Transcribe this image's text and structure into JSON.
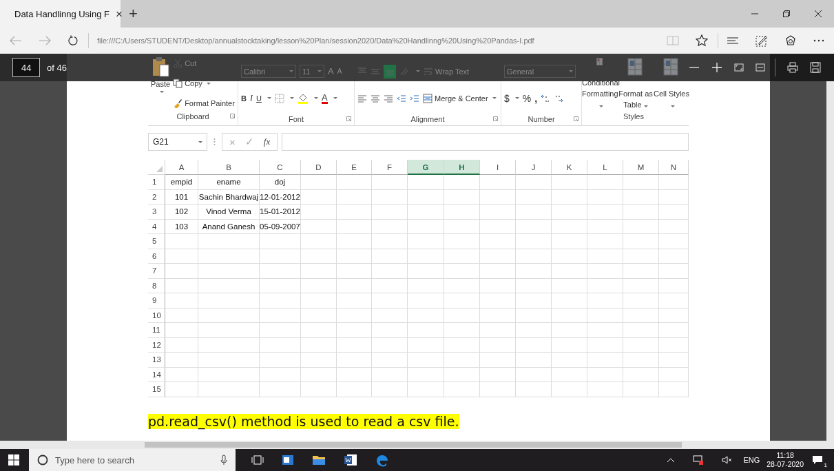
{
  "browser": {
    "tab_title": "Data Handlinng Using F",
    "tab_close": "×",
    "new_tab": "+",
    "url": "file:///C:/Users/STUDENT/Desktop/annualstocktaking/lesson%20Plan/session2020/Data%20Handlinng%20Using%20Pandas-I.pdf"
  },
  "pdf_toolbar": {
    "page": "44",
    "page_count": "of 46"
  },
  "ribbon": {
    "clipboard": {
      "paste": "Paste",
      "cut": "Cut",
      "copy": "Copy",
      "format_painter": "Format Painter",
      "label": "Clipboard"
    },
    "font": {
      "name": "Calibri",
      "size": "11",
      "grow": "A",
      "shrink": "A",
      "bold": "B",
      "italic": "I",
      "underline": "U",
      "font_color": "A",
      "label": "Font"
    },
    "alignment": {
      "wrap_text": "Wrap Text",
      "merge": "Merge & Center",
      "label": "Alignment"
    },
    "number": {
      "format": "General",
      "currency": "$",
      "percent": "%",
      "comma": ",",
      "label": "Number"
    },
    "styles": {
      "buttons": [
        "Conditional Formatting",
        "Format as Table",
        "Cell Styles"
      ],
      "label": "Styles"
    }
  },
  "formula_bar": {
    "name_box": "G21",
    "cancel": "×",
    "enter": "✓",
    "function": "fx"
  },
  "sheet": {
    "columns": [
      {
        "label": "A",
        "selected": false
      },
      {
        "label": "B",
        "selected": false
      },
      {
        "label": "C",
        "selected": false
      },
      {
        "label": "D",
        "selected": false
      },
      {
        "label": "E",
        "selected": false
      },
      {
        "label": "F",
        "selected": false
      },
      {
        "label": "G",
        "selected": true
      },
      {
        "label": "H",
        "selected": true
      },
      {
        "label": "I",
        "selected": false
      },
      {
        "label": "J",
        "selected": false
      },
      {
        "label": "K",
        "selected": false
      },
      {
        "label": "L",
        "selected": false
      },
      {
        "label": "M",
        "selected": false
      },
      {
        "label": "N",
        "selected": false
      }
    ],
    "rows": [
      {
        "number": "1",
        "cells": [
          "empid",
          "ename",
          "doj"
        ]
      },
      {
        "number": "2",
        "cells": [
          "101",
          "Sachin Bhardwaj",
          "12-01-2012"
        ]
      },
      {
        "number": "3",
        "cells": [
          "102",
          "Vinod Verma",
          "15-01-2012"
        ]
      },
      {
        "number": "4",
        "cells": [
          "103",
          "Anand Ganesh",
          "05-09-2007"
        ]
      },
      {
        "number": "5"
      },
      {
        "number": "6"
      },
      {
        "number": "7"
      },
      {
        "number": "8"
      },
      {
        "number": "9"
      },
      {
        "number": "10"
      },
      {
        "number": "11"
      },
      {
        "number": "12"
      },
      {
        "number": "13"
      },
      {
        "number": "14"
      },
      {
        "number": "15"
      }
    ]
  },
  "caption": "pd.read_csv() method is used to read a csv file.",
  "taskbar": {
    "search_placeholder": "Type here to search",
    "language": "ENG",
    "time": "11:18",
    "date": "28-07-2020",
    "notifications": "1"
  }
}
